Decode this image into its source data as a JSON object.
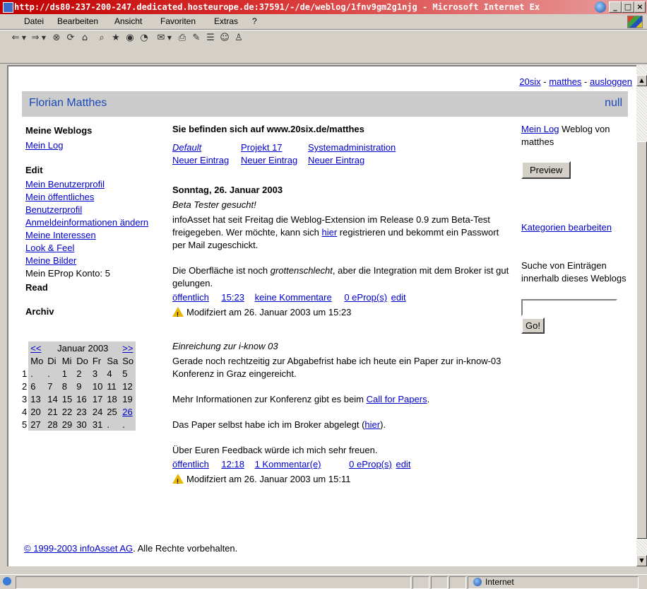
{
  "window": {
    "title": "http://ds80-237-200-247.dedicated.hosteurope.de:37591/-/de/weblog/1fnv9gm2g1njg - Microsoft Internet Ex",
    "minimize": "_",
    "maximize": "□",
    "close": "×"
  },
  "menu": [
    "Datei",
    "Bearbeiten",
    "Ansicht",
    "Favoriten",
    "Extras",
    "?"
  ],
  "toolbar_icons": [
    "back-icon",
    "dropdown-icon",
    "forward-icon",
    "dropdown-icon",
    "stop-icon",
    "refresh-icon",
    "home-icon",
    "search-icon",
    "favorites-icon",
    "media-icon",
    "history-icon",
    "mail-icon",
    "print-icon",
    "edit-icon",
    "discuss-icon",
    "messenger-icon",
    "research-icon"
  ],
  "topnav": {
    "site": "20six",
    "user": "matthes",
    "logout": "ausloggen",
    "sep": " - "
  },
  "header": {
    "owner": "Florian Matthes",
    "right": "null"
  },
  "left": {
    "weblogs_heading": "Meine Weblogs",
    "my_log": "Mein Log",
    "edit_heading": "Edit",
    "edit_links": [
      "Mein Benutzerprofil",
      "Mein öffentliches",
      "Benutzerprofil",
      "Anmeldeinformationen ändern",
      "Meine Interessen",
      "Look & Feel",
      "Meine Bilder"
    ],
    "eprop": "Mein EProp Konto: 5",
    "read_heading": "Read",
    "archive_heading": "Archiv",
    "calendar": {
      "prev": "<<",
      "month": "Januar 2003",
      "next": ">>",
      "days": [
        "Mo",
        "Di",
        "Mi",
        "Do",
        "Fr",
        "Sa",
        "So"
      ],
      "weeks": [
        {
          "wk": "1",
          "d": [
            ".",
            ".",
            "1",
            "2",
            "3",
            "4",
            "5"
          ]
        },
        {
          "wk": "2",
          "d": [
            "6",
            "7",
            "8",
            "9",
            "10",
            "11",
            "12"
          ]
        },
        {
          "wk": "3",
          "d": [
            "13",
            "14",
            "15",
            "16",
            "17",
            "18",
            "19"
          ]
        },
        {
          "wk": "4",
          "d": [
            "20",
            "21",
            "22",
            "23",
            "24",
            "25",
            "26"
          ]
        },
        {
          "wk": "5",
          "d": [
            "27",
            "28",
            "29",
            "30",
            "31",
            ".",
            "."
          ]
        }
      ],
      "linked_day": "26"
    }
  },
  "center": {
    "location": "Sie befinden sich auf www.20six.de/matthes",
    "categories": [
      {
        "name": "Default",
        "new": "Neuer Eintrag"
      },
      {
        "name": "Projekt 17",
        "new": "Neuer Eintrag"
      },
      {
        "name": "Systemadministration",
        "new": "Neuer Eintrag"
      }
    ],
    "date": "Sonntag, 26. Januar 2003",
    "post1": {
      "title": "Beta Tester gesucht!",
      "p1_a": "infoAsset hat seit Freitag die Weblog-Extension im Release 0.9 zum Beta-Test freigegeben. Wer möchte, kann sich ",
      "p1_link": "hier",
      "p1_b": " registrieren und bekommt ein Passwort per Mail zugeschickt.",
      "p2_a": "Die Oberfläche ist noch ",
      "p2_em": "grottenschlecht",
      "p2_b": ", aber die Integration mit dem Broker ist gut gelungen.",
      "meta": {
        "visibility": "öffentlich",
        "time": "15:23",
        "comments": "keine Kommentare",
        "eprops": "0 eProp(s)",
        "edit": "edit"
      },
      "modified": "Modifziert am 26. Januar 2003 um 15:23"
    },
    "post2": {
      "title": "Einreichung zur i-know 03",
      "p1": "Gerade noch rechtzeitig zur Abgabefrist habe ich heute ein Paper zur in-know-03 Konferenz in Graz eingereicht.",
      "p2_a": "Mehr Informationen zur Konferenz gibt es beim ",
      "p2_link": "Call for Papers",
      "p2_b": ".",
      "p3_a": "Das Paper selbst habe ich im Broker abgelegt (",
      "p3_link": "hier",
      "p3_b": ").",
      "p4": "Über Euren Feedback würde ich mich sehr freuen.",
      "meta": {
        "visibility": "öffentlich",
        "time": "12:18",
        "comments": "1 Kommentar(e)",
        "eprops": "0 eProp(s)",
        "edit": "edit"
      },
      "modified": "Modifziert am 26. Januar 2003 um 15:11"
    }
  },
  "right": {
    "mylog_link": "Mein Log",
    "mylog_text": " Weblog von matthes",
    "preview": "Preview",
    "edit_categories": "Kategorien bearbeiten",
    "search_text": "Suche von Einträgen innerhalb dieses Weblogs",
    "search_value": "",
    "go": "Go!"
  },
  "footer": {
    "copy_link": "© 1999-2003 infoAsset AG",
    "rest": ". Alle Rechte vorbehalten."
  },
  "status": {
    "zone": "Internet"
  },
  "colors": {
    "title_bar": "#c00000",
    "header_band": "#cccccc",
    "owner_text": "#1a48b8",
    "link": "#0000cc",
    "warning": "#e8b600"
  }
}
